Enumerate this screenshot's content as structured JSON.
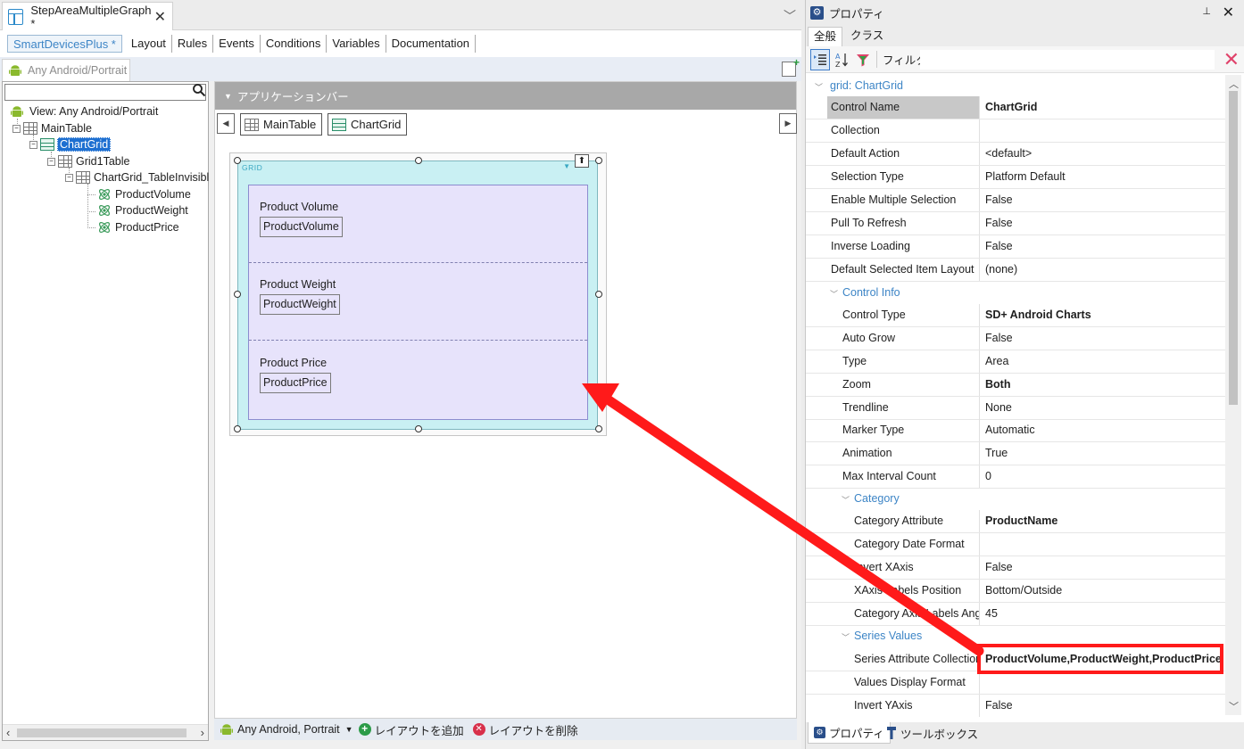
{
  "document_tab": {
    "title": "StepAreaMultipleGraph *"
  },
  "part_tabs": [
    "SmartDevicesPlus *",
    "Layout",
    "Rules",
    "Events",
    "Conditions",
    "Variables",
    "Documentation"
  ],
  "platform_tab": {
    "label": "Any Android/Portrait"
  },
  "tree": {
    "search_value": "",
    "nodes": {
      "view": "View: Any Android/Portrait",
      "main_table": "MainTable",
      "chart_grid": "ChartGrid",
      "grid1_table": "Grid1Table",
      "invisible_table": "ChartGrid_TableInvisibl",
      "product_volume": "ProductVolume",
      "product_weight": "ProductWeight",
      "product_price": "ProductPrice"
    }
  },
  "designer": {
    "appbar_label": "アプリケーションバー",
    "crumbs": [
      "MainTable",
      "ChartGrid"
    ],
    "grid_label": "GRID",
    "cells": [
      {
        "label": "Product Volume",
        "field": "ProductVolume"
      },
      {
        "label": "Product Weight",
        "field": "ProductWeight"
      },
      {
        "label": "Product Price",
        "field": "ProductPrice"
      }
    ],
    "status": {
      "platform": "Any Android, Portrait",
      "add_layout": "レイアウトを追加",
      "delete_layout": "レイアウトを削除"
    }
  },
  "properties": {
    "title": "プロパティ",
    "tabs": [
      "全般",
      "クラス"
    ],
    "filter_label": "フィルタ",
    "filter_value": "",
    "header": "grid: ChartGrid",
    "rows": [
      {
        "name": "Control Name",
        "value": "ChartGrid",
        "bold": true
      },
      {
        "name": "Collection",
        "value": ""
      },
      {
        "name": "Default Action",
        "value": "<default>"
      },
      {
        "name": "Selection Type",
        "value": "Platform Default"
      },
      {
        "name": "Enable Multiple Selection",
        "value": "False"
      },
      {
        "name": "Pull To Refresh",
        "value": "False"
      },
      {
        "name": "Inverse Loading",
        "value": "False"
      },
      {
        "name": "Default Selected Item Layout",
        "value": "(none)"
      }
    ],
    "control_info": {
      "title": "Control Info",
      "rows": [
        {
          "name": "Control Type",
          "value": "SD+ Android Charts",
          "bold": true
        },
        {
          "name": "Auto Grow",
          "value": "False"
        },
        {
          "name": "Type",
          "value": "Area"
        },
        {
          "name": "Zoom",
          "value": "Both",
          "bold": true
        },
        {
          "name": "Trendline",
          "value": "None"
        },
        {
          "name": "Marker Type",
          "value": "Automatic"
        },
        {
          "name": "Animation",
          "value": "True"
        },
        {
          "name": "Max Interval Count",
          "value": "0"
        }
      ]
    },
    "category": {
      "title": "Category",
      "rows": [
        {
          "name": "Category Attribute",
          "value": "ProductName",
          "bold": true
        },
        {
          "name": "Category Date Format",
          "value": ""
        },
        {
          "name": "Invert XAxis",
          "value": "False"
        },
        {
          "name": "XAxis Labels Position",
          "value": "Bottom/Outside"
        },
        {
          "name": "Category Axis Labels Angle",
          "value": "45"
        }
      ]
    },
    "series_values": {
      "title": "Series Values",
      "rows": [
        {
          "name": "Series Attribute Collection",
          "value": "ProductVolume,ProductWeight,ProductPrice",
          "bold": true
        },
        {
          "name": "Values Display Format",
          "value": ""
        },
        {
          "name": "Invert YAxis",
          "value": "False"
        }
      ]
    },
    "bottom_tabs": [
      "プロパティ",
      "ツールボックス"
    ]
  },
  "colors": {
    "accent": "#3d85c6",
    "highlight": "#ff1a1a",
    "selection": "#1d6fd1"
  }
}
